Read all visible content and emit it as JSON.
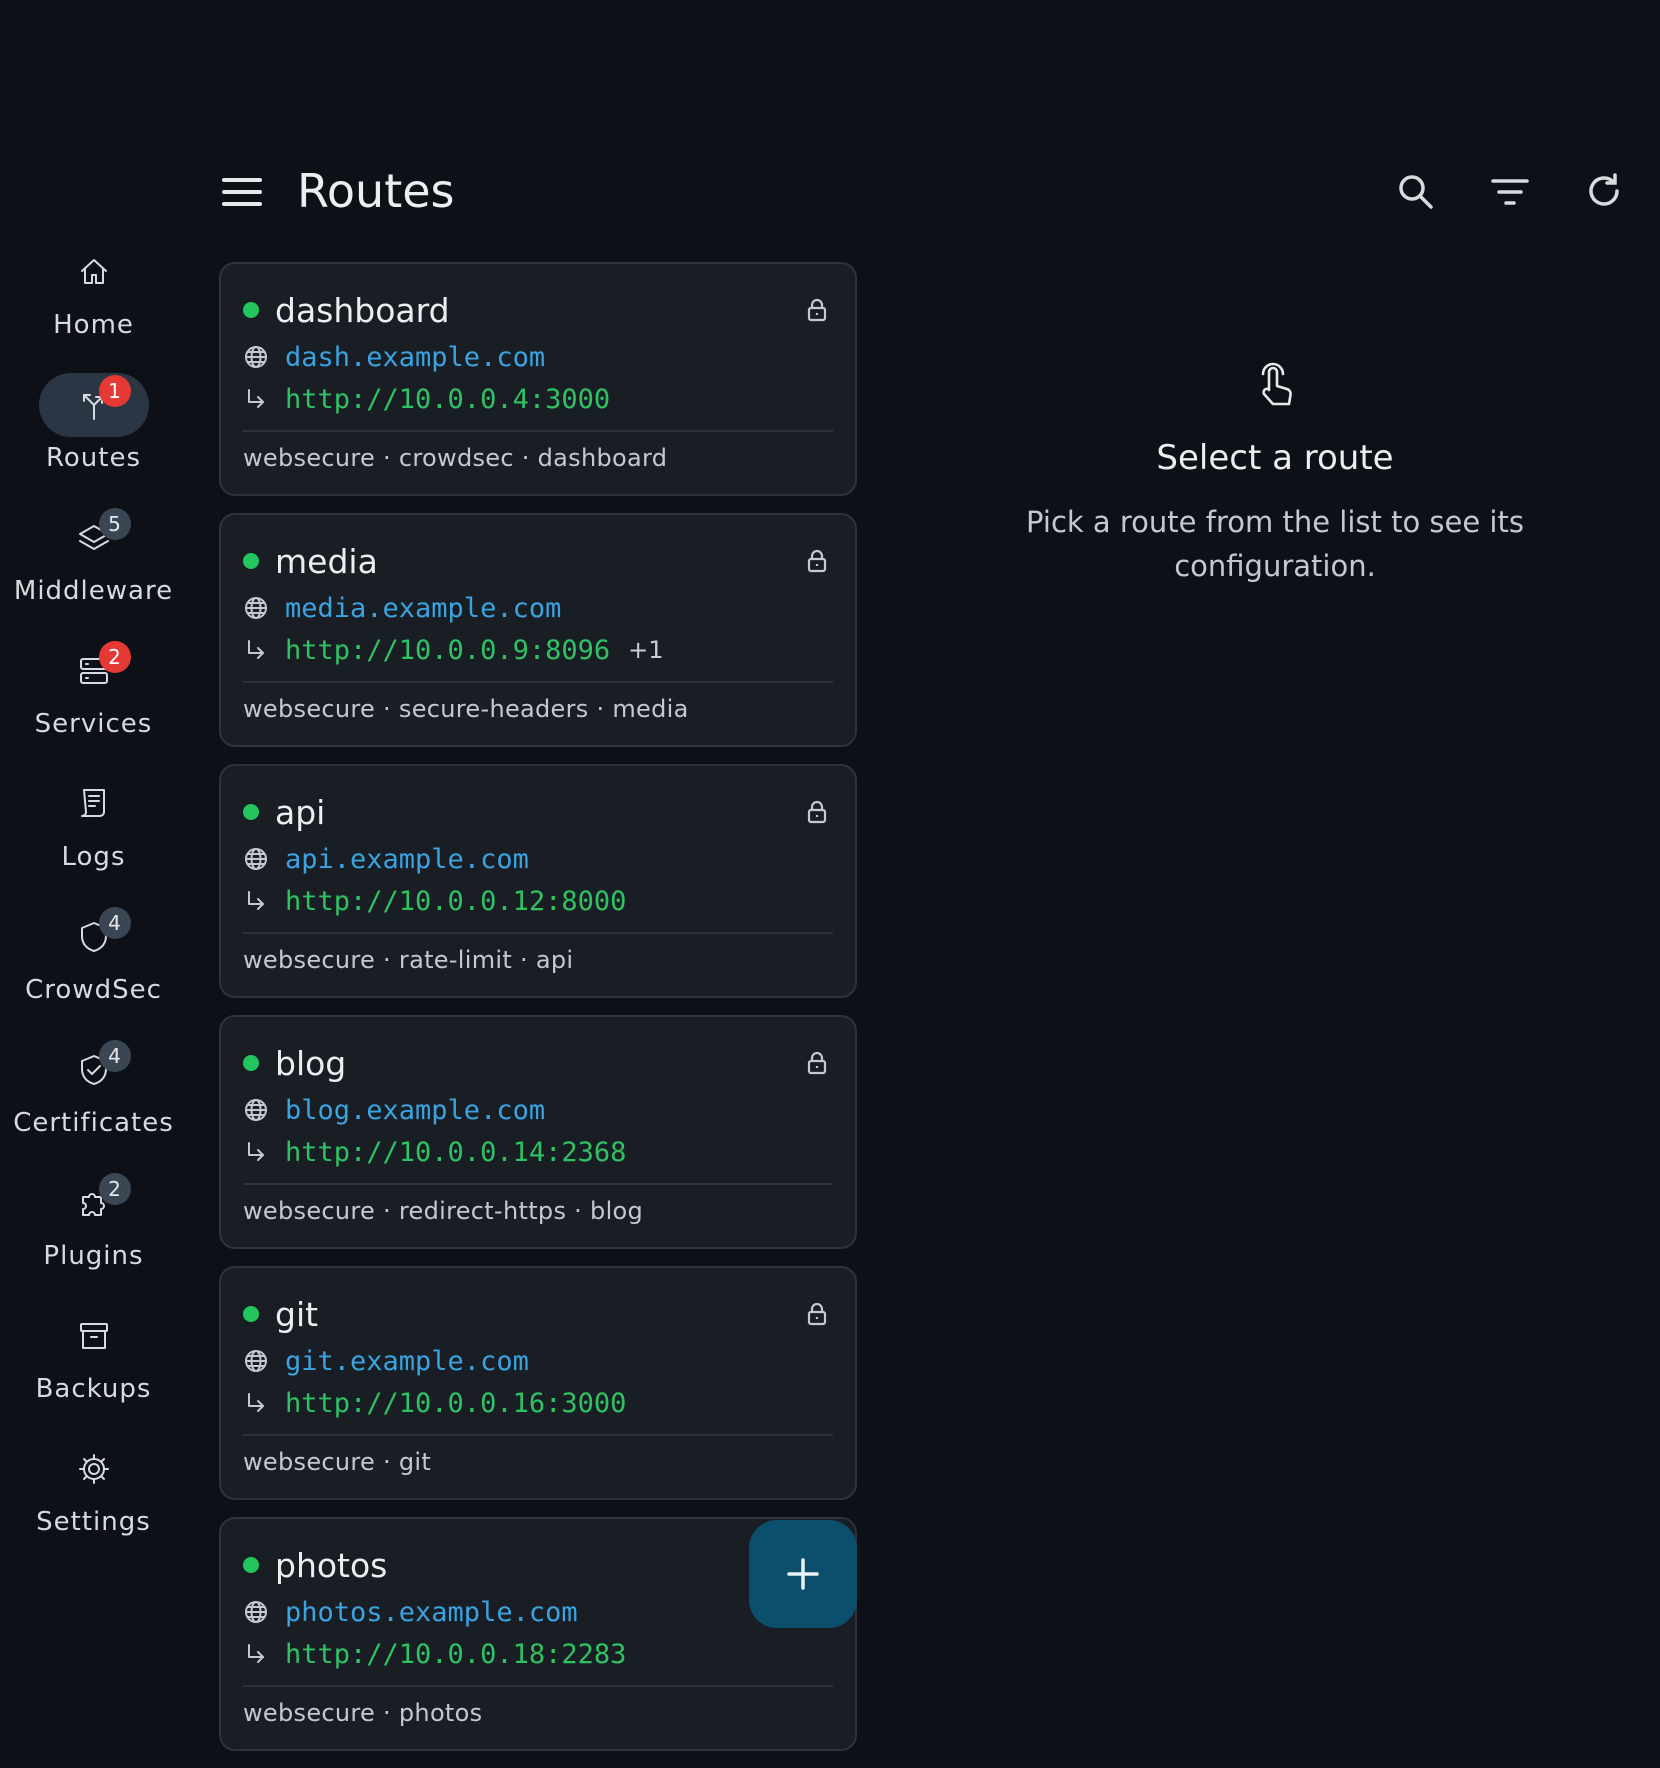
{
  "header": {
    "title": "Routes",
    "actions": [
      {
        "name": "search",
        "icon": "search-icon"
      },
      {
        "name": "filter",
        "icon": "filter-icon"
      },
      {
        "name": "refresh",
        "icon": "refresh-icon"
      }
    ]
  },
  "nav": {
    "items": [
      {
        "id": "home",
        "label": "Home",
        "icon": "home-icon",
        "badge": null,
        "active": false
      },
      {
        "id": "routes",
        "label": "Routes",
        "icon": "routes-icon",
        "badge": "1",
        "badge_style": "alert",
        "active": true
      },
      {
        "id": "middleware",
        "label": "Middleware",
        "icon": "layers-icon",
        "badge": "5",
        "badge_style": "neutral",
        "active": false
      },
      {
        "id": "services",
        "label": "Services",
        "icon": "server-icon",
        "badge": "2",
        "badge_style": "alert",
        "active": false
      },
      {
        "id": "logs",
        "label": "Logs",
        "icon": "logs-icon",
        "badge": null,
        "active": false
      },
      {
        "id": "crowdsec",
        "label": "CrowdSec",
        "icon": "shield-icon",
        "badge": "4",
        "badge_style": "neutral",
        "active": false
      },
      {
        "id": "certificates",
        "label": "Certificates",
        "icon": "shield-check-icon",
        "badge": "4",
        "badge_style": "neutral",
        "active": false
      },
      {
        "id": "plugins",
        "label": "Plugins",
        "icon": "puzzle-icon",
        "badge": "2",
        "badge_style": "neutral",
        "active": false
      },
      {
        "id": "backups",
        "label": "Backups",
        "icon": "archive-icon",
        "badge": null,
        "active": false
      },
      {
        "id": "settings",
        "label": "Settings",
        "icon": "gear-icon",
        "badge": null,
        "active": false
      }
    ]
  },
  "routes": [
    {
      "name": "dashboard",
      "host": "dash.example.com",
      "target": "http://10.0.0.4:3000",
      "extra": "",
      "tags": "websecure · crowdsec · dashboard",
      "locked": true
    },
    {
      "name": "media",
      "host": "media.example.com",
      "target": "http://10.0.0.9:8096",
      "extra": "+1",
      "tags": "websecure · secure-headers · media",
      "locked": true
    },
    {
      "name": "api",
      "host": "api.example.com",
      "target": "http://10.0.0.12:8000",
      "extra": "",
      "tags": "websecure · rate-limit · api",
      "locked": true
    },
    {
      "name": "blog",
      "host": "blog.example.com",
      "target": "http://10.0.0.14:2368",
      "extra": "",
      "tags": "websecure · redirect-https · blog",
      "locked": true
    },
    {
      "name": "git",
      "host": "git.example.com",
      "target": "http://10.0.0.16:3000",
      "extra": "",
      "tags": "websecure · git",
      "locked": true
    },
    {
      "name": "photos",
      "host": "photos.example.com",
      "target": "http://10.0.0.18:2283",
      "extra": "",
      "tags": "websecure · photos",
      "locked": false
    }
  ],
  "detail": {
    "title": "Select a route",
    "subtitle": "Pick a route from the list to see its configuration."
  },
  "colors": {
    "background": "#0d1117",
    "card": "#191e25",
    "host": "#3ba3e0",
    "target": "#2fc263",
    "status_ok": "#22c55e",
    "badge_alert": "#e53935",
    "fab": "#0b4f6c"
  }
}
